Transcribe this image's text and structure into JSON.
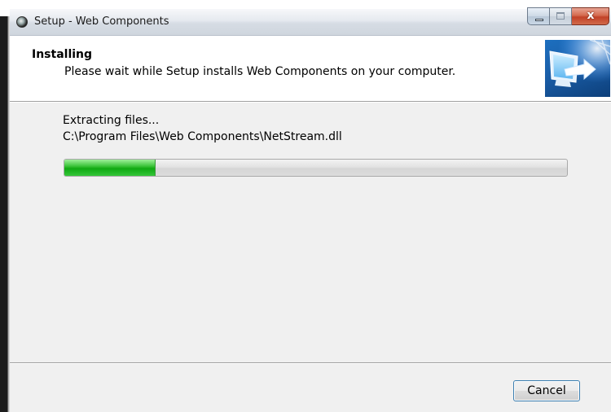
{
  "window": {
    "title": "Setup - Web Components",
    "close_glyph": "x"
  },
  "header": {
    "title": "Installing",
    "subtitle": "Please wait while Setup installs Web Components on your computer.",
    "image_icon": "monitor-with-arrow-icon"
  },
  "main": {
    "status": "Extracting files...",
    "file_path": "C:\\Program Files\\Web Components\\NetStream.dll",
    "progress_fraction": 0.18
  },
  "footer": {
    "cancel_label": "Cancel"
  },
  "colors": {
    "progress_fill": "#10a912",
    "header_image_bg": "#1a5ea8",
    "close_button": "#c24127"
  }
}
